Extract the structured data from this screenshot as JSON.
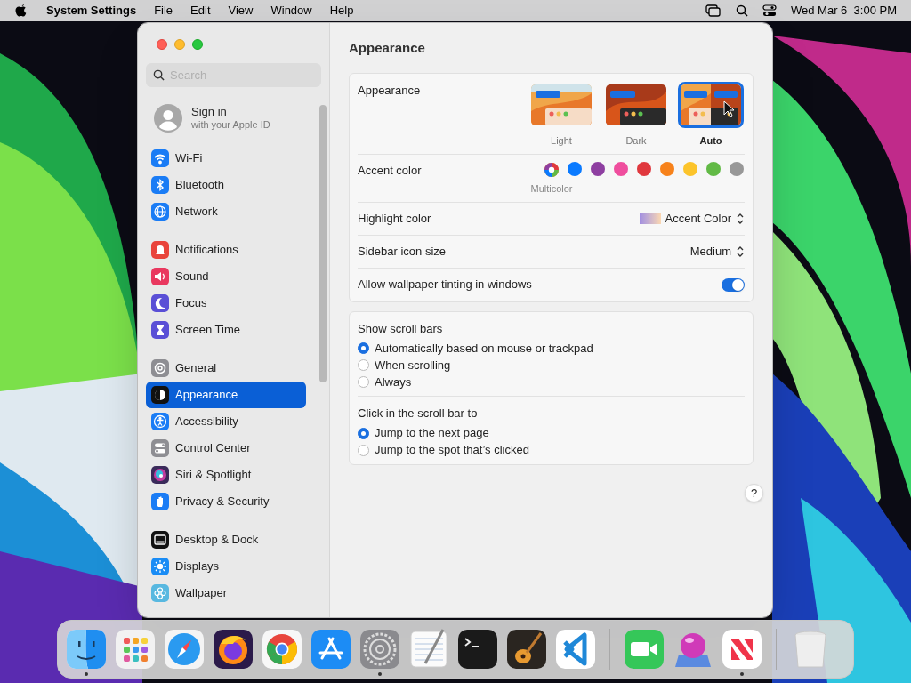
{
  "menu_bar": {
    "app_name": "System Settings",
    "menus": [
      "File",
      "Edit",
      "View",
      "Window",
      "Help"
    ],
    "clock": "Wed Mar 6  3:00 PM"
  },
  "sidebar": {
    "search": {
      "placeholder": "Search"
    },
    "account": {
      "title": "Sign in",
      "subtitle": "with your Apple ID"
    },
    "groups": [
      [
        {
          "label": "Wi-Fi",
          "selected": false
        },
        {
          "label": "Bluetooth",
          "selected": false
        },
        {
          "label": "Network",
          "selected": false
        }
      ],
      [
        {
          "label": "Notifications",
          "selected": false
        },
        {
          "label": "Sound",
          "selected": false
        },
        {
          "label": "Focus",
          "selected": false
        },
        {
          "label": "Screen Time",
          "selected": false
        }
      ],
      [
        {
          "label": "General",
          "selected": false
        },
        {
          "label": "Appearance",
          "selected": true
        },
        {
          "label": "Accessibility",
          "selected": false
        },
        {
          "label": "Control Center",
          "selected": false
        },
        {
          "label": "Siri & Spotlight",
          "selected": false
        },
        {
          "label": "Privacy & Security",
          "selected": false
        }
      ],
      [
        {
          "label": "Desktop & Dock",
          "selected": false
        },
        {
          "label": "Displays",
          "selected": false
        },
        {
          "label": "Wallpaper",
          "selected": false
        }
      ]
    ]
  },
  "content": {
    "title": "Appearance",
    "appearance": {
      "label": "Appearance",
      "options": [
        {
          "label": "Light",
          "kind": "light",
          "selected": false
        },
        {
          "label": "Dark",
          "kind": "dark",
          "selected": false
        },
        {
          "label": "Auto",
          "kind": "auto",
          "selected": true
        }
      ]
    },
    "accent": {
      "label": "Accent color",
      "caption": "Multicolor",
      "colors": [
        {
          "kind": "multicolor",
          "selected": true
        },
        {
          "kind": "solid",
          "color": "#0a7aff",
          "selected": false
        },
        {
          "kind": "solid",
          "color": "#8e3fa1",
          "selected": false
        },
        {
          "kind": "solid",
          "color": "#ef4e9e",
          "selected": false
        },
        {
          "kind": "solid",
          "color": "#e0383e",
          "selected": false
        },
        {
          "kind": "solid",
          "color": "#f7821b",
          "selected": false
        },
        {
          "kind": "solid",
          "color": "#fcc42b",
          "selected": false
        },
        {
          "kind": "solid",
          "color": "#62ba46",
          "selected": false
        },
        {
          "kind": "solid",
          "color": "#989898",
          "selected": false
        }
      ]
    },
    "highlight": {
      "label": "Highlight color",
      "value": "Accent Color"
    },
    "icon_size": {
      "label": "Sidebar icon size",
      "value": "Medium"
    },
    "tinting": {
      "label": "Allow wallpaper tinting in windows",
      "on": true
    },
    "scroll_groups": [
      {
        "title": "Show scroll bars",
        "options": [
          {
            "label": "Automatically based on mouse or trackpad",
            "selected": true
          },
          {
            "label": "When scrolling",
            "selected": false
          },
          {
            "label": "Always",
            "selected": false
          }
        ]
      },
      {
        "title": "Click in the scroll bar to",
        "options": [
          {
            "label": "Jump to the next page",
            "selected": true
          },
          {
            "label": "Jump to the spot that’s clicked",
            "selected": false
          }
        ]
      }
    ],
    "help": "?"
  },
  "dock": {
    "sections": [
      [
        {
          "running": true
        },
        {
          "running": false
        },
        {
          "running": false
        },
        {
          "running": false
        },
        {
          "running": false
        },
        {
          "running": false
        },
        {
          "running": true
        },
        {
          "running": false
        },
        {
          "running": false
        },
        {
          "running": false
        },
        {
          "running": false
        }
      ],
      [
        {
          "running": false
        },
        {
          "running": false
        },
        {
          "running": true
        }
      ],
      [
        {
          "running": false
        }
      ]
    ]
  }
}
